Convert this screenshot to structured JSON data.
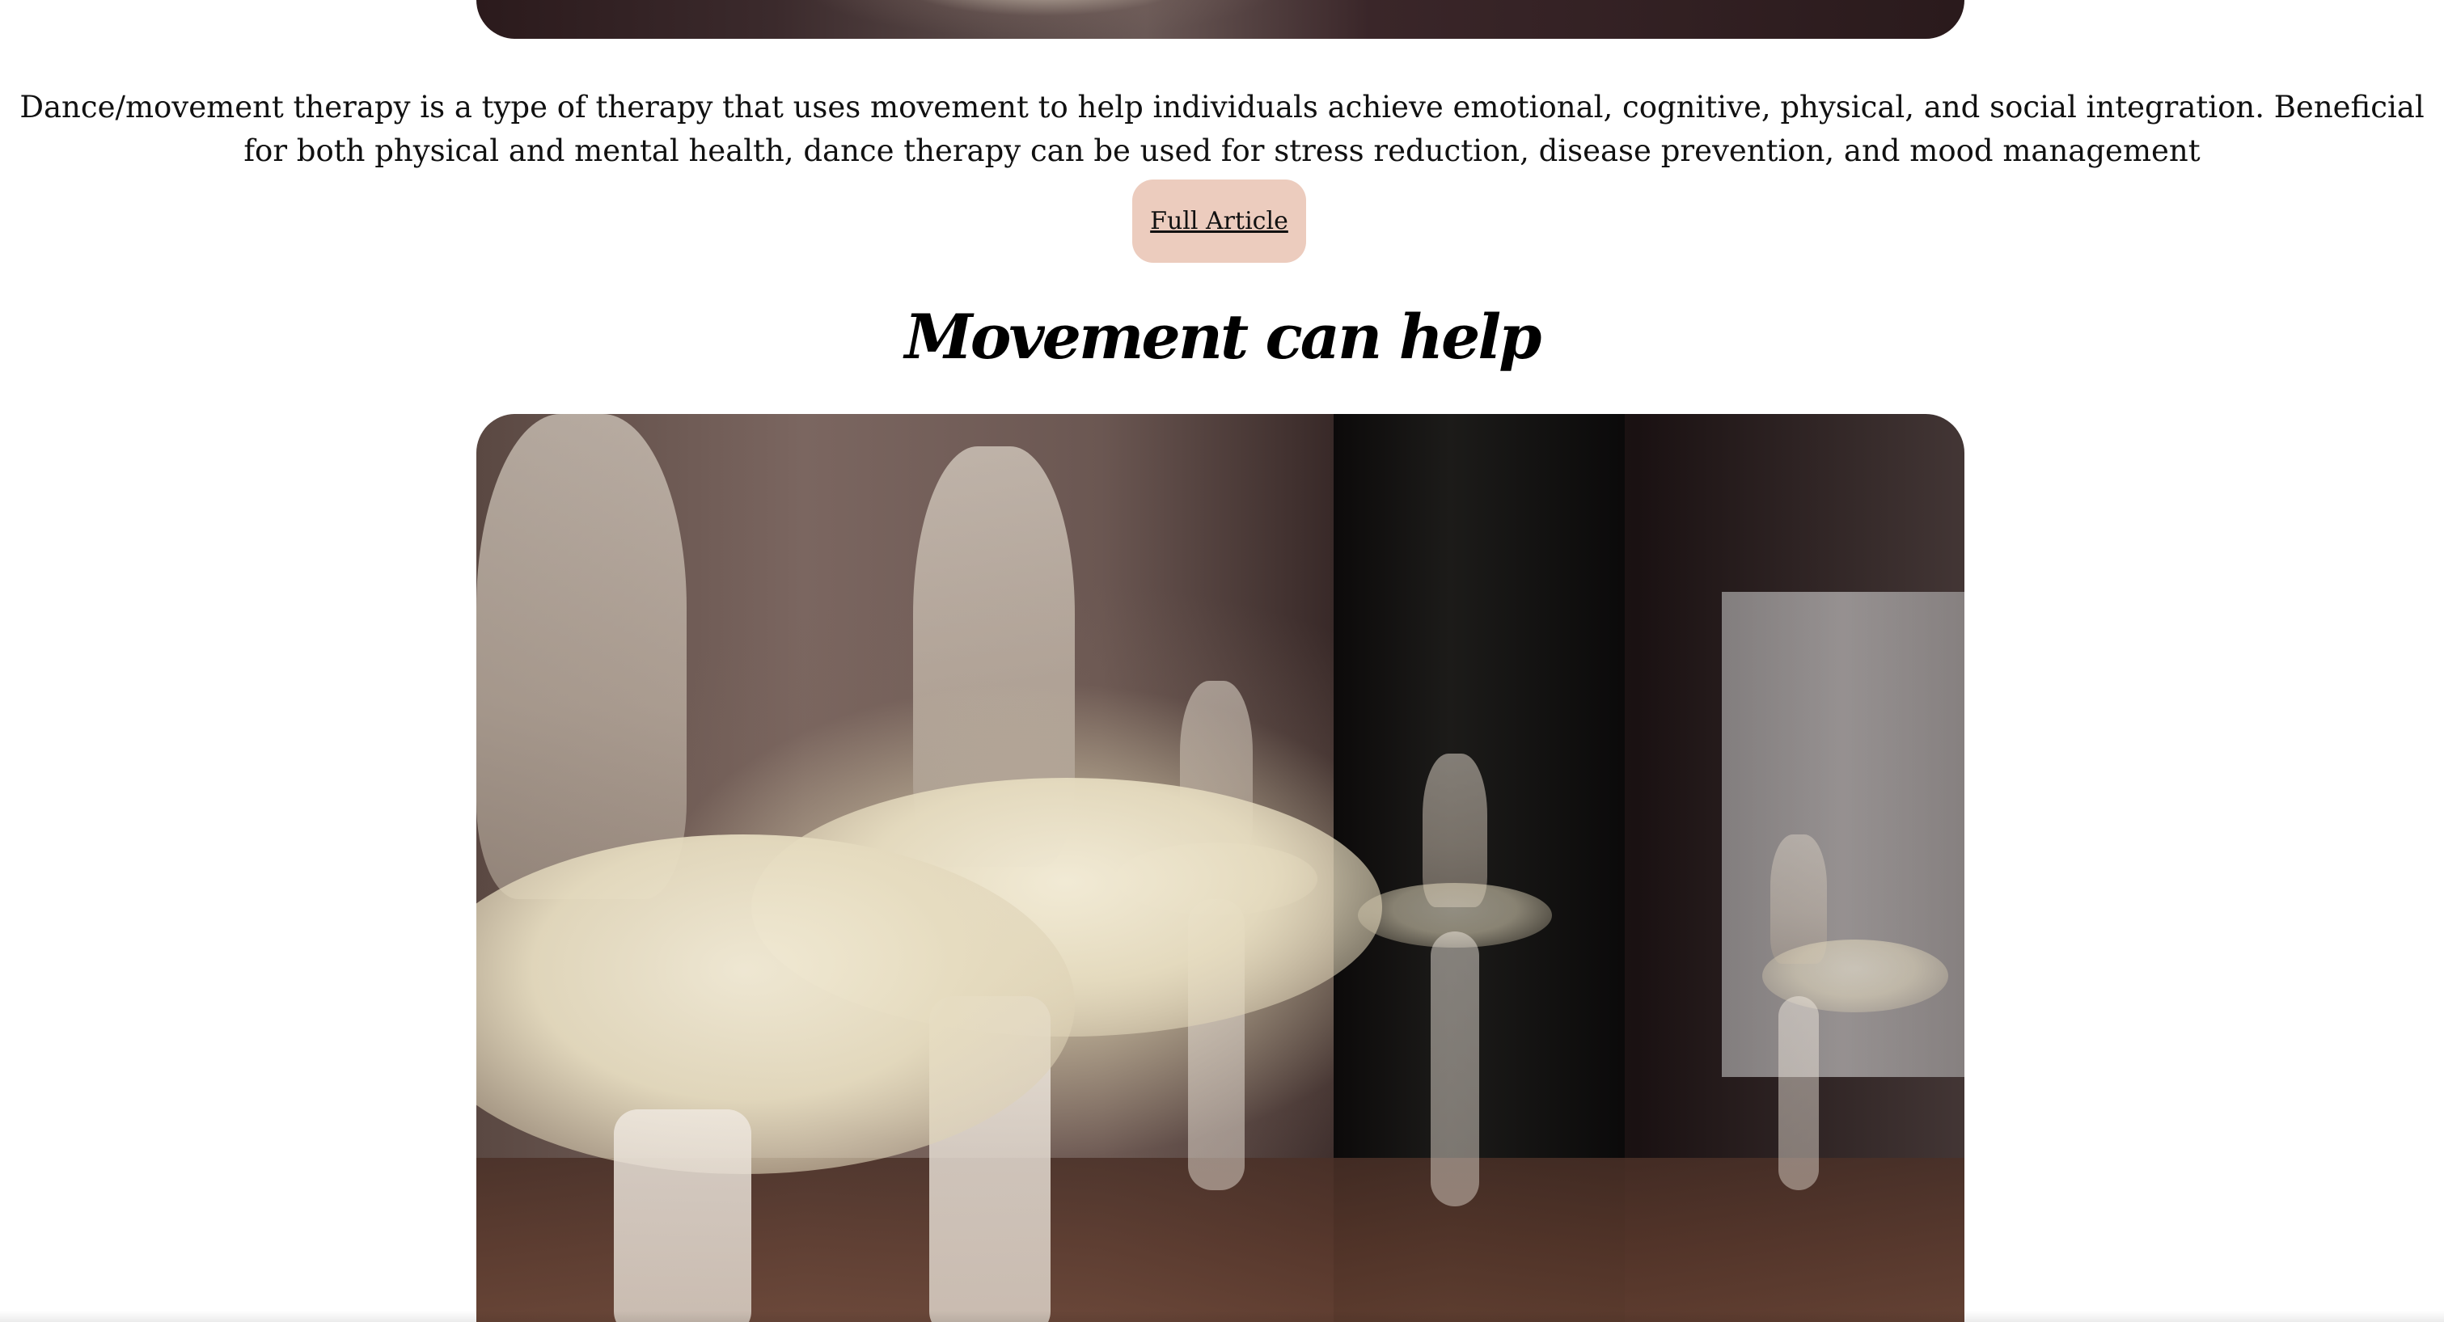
{
  "article": {
    "intro_text": "Dance/movement therapy is a type of therapy that uses movement to help individuals achieve emotional, cognitive, physical, and social integration. Beneficial for both physical and mental health, dance therapy can be used for stress reduction, disease prevention, and mood management",
    "full_article_label": "Full Article"
  },
  "section": {
    "heading": "Movement can help"
  },
  "images": {
    "top_photo_icon": "photo-icon",
    "ballet_photo_icon": "photo-icon"
  },
  "colors": {
    "button_background": "#ecccbe",
    "text": "#111111",
    "page_background": "#ffffff"
  }
}
